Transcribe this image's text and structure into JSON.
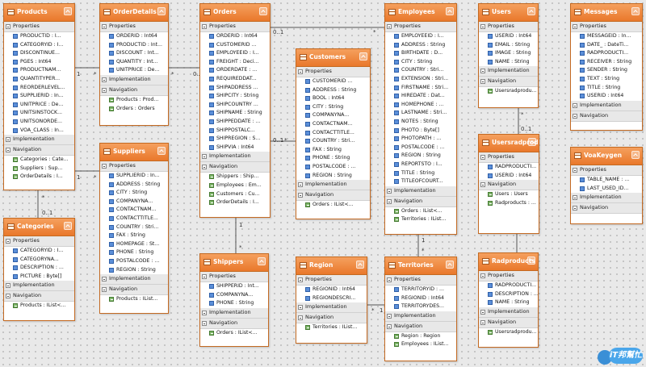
{
  "entities": [
    {
      "name": "Products",
      "sections": [
        {
          "title": "Properties",
          "items": [
            "PRODUCTID : I...",
            "CATEGORYID : I...",
            "DISCONTINUE...",
            "PGES : Int64",
            "PRODUCTNAM...",
            "QUANTITYPER...",
            "REORDERLEVEL...",
            "SUPPLIERID : In...",
            "UNITPRICE : De...",
            "UNITSINSTOCK...",
            "UNITSONORDE...",
            "VOA_CLASS : In..."
          ]
        },
        {
          "title": "Implementation",
          "items": []
        },
        {
          "title": "Navigation",
          "items": [
            "Categories : Cate...",
            "Suppliers : Sup...",
            "OrderDetails : I..."
          ]
        }
      ]
    },
    {
      "name": "OrderDetails",
      "sections": [
        {
          "title": "Properties",
          "items": [
            "ORDERID : Int64",
            "PRODUCTID : Int...",
            "DISCOUNT : Int...",
            "QUANTITY : Int...",
            "UNITPRICE : De..."
          ]
        },
        {
          "title": "Implementation",
          "items": []
        },
        {
          "title": "Navigation",
          "items": [
            "Products : Prod...",
            "Orders : Orders"
          ]
        }
      ]
    },
    {
      "name": "Orders",
      "sections": [
        {
          "title": "Properties",
          "items": [
            "ORDERID : Int64",
            "CUSTOMERID ...",
            "EMPLOYEEID : I...",
            "FREIGHT : Deci...",
            "ORDERDATE : ...",
            "REQUIREDDAT...",
            "SHIPADDRESS ...",
            "SHIPCITY : String",
            "SHIPCOUNTRY ...",
            "SHIPNAME : String",
            "SHIPPEDDATE : ...",
            "SHIPPOSTALC...",
            "SHIPREGION : S...",
            "SHIPVIA : Int64"
          ]
        },
        {
          "title": "Implementation",
          "items": []
        },
        {
          "title": "Navigation",
          "items": [
            "Shippers : Ship...",
            "Employees : Em...",
            "Customers : Cu...",
            "OrderDetails : I..."
          ]
        }
      ]
    },
    {
      "name": "Employees",
      "sections": [
        {
          "title": "Properties",
          "items": [
            "EMPLOYEEID : I...",
            "ADDRESS : String",
            "BIRTHDATE : D...",
            "CITY : String",
            "COUNTRY : Stri...",
            "EXTENSION : Stri...",
            "FIRSTNAME : Stri...",
            "HIREDATE : Dat...",
            "HOMEPHONE : ...",
            "LASTNAME : Stri...",
            "NOTES : String",
            "PHOTO : Byte[]",
            "PHOTOPATH : ...",
            "POSTALCODE : ...",
            "REGION : String",
            "REPORTSTO : I...",
            "TITLE : String",
            "TITLEOFCOURT..."
          ]
        },
        {
          "title": "Implementation",
          "items": []
        },
        {
          "title": "Navigation",
          "items": [
            "Orders : IList<...",
            "Territories : IList..."
          ]
        }
      ]
    },
    {
      "name": "Users",
      "sections": [
        {
          "title": "Properties",
          "items": [
            "USERID : Int64",
            "EMAIL : String",
            "IMAGE : String",
            "NAME : String"
          ]
        },
        {
          "title": "Implementation",
          "items": []
        },
        {
          "title": "Navigation",
          "items": [
            "Usersradprodu..."
          ]
        }
      ]
    },
    {
      "name": "Messages",
      "sections": [
        {
          "title": "Properties",
          "items": [
            "MESSAGEID : In...",
            "DATE_ : DateTi...",
            "RADPRODUCTI...",
            "RECEIVER : String",
            "SENDER : String",
            "TEXT : String",
            "TITLE : String",
            "USERID : Int64"
          ]
        },
        {
          "title": "Implementation",
          "items": []
        },
        {
          "title": "Navigation",
          "items": []
        }
      ]
    },
    {
      "name": "Customers",
      "sections": [
        {
          "title": "Properties",
          "items": [
            "CUSTOMERID ...",
            "ADDRESS : String",
            "BOOL : Int64",
            "CITY : String",
            "COMPANYNA...",
            "CONTACTNAM...",
            "CONTACTTITLE...",
            "COUNTRY : Stri...",
            "FAX : String",
            "PHONE : String",
            "POSTALCODE : ...",
            "REGION : String"
          ]
        },
        {
          "title": "Implementation",
          "items": []
        },
        {
          "title": "Navigation",
          "items": [
            "Orders : IList<..."
          ]
        }
      ]
    },
    {
      "name": "Suppliers",
      "sections": [
        {
          "title": "Properties",
          "items": [
            "SUPPLIERID : In...",
            "ADDRESS : String",
            "CITY : String",
            "COMPANYNA...",
            "CONTACTNAM...",
            "CONTACTTITLE...",
            "COUNTRY : Stri...",
            "FAX : String",
            "HOMEPAGE : St...",
            "PHONE : String",
            "POSTALCODE : ...",
            "REGION : String"
          ]
        },
        {
          "title": "Implementation",
          "items": []
        },
        {
          "title": "Navigation",
          "items": [
            "Products : IList..."
          ]
        }
      ]
    },
    {
      "name": "Usersradprodu...",
      "sections": [
        {
          "title": "Properties",
          "items": [
            "RADPRODUCTI...",
            "USERID : Int64"
          ]
        },
        {
          "title": "Navigation",
          "items": [
            "Users : Users",
            "Radproducts : ..."
          ]
        }
      ]
    },
    {
      "name": "VoaKeygen",
      "sections": [
        {
          "title": "Properties",
          "items": [
            "TABLE_NAME : ...",
            "LAST_USED_ID..."
          ]
        },
        {
          "title": "Implementation",
          "items": []
        },
        {
          "title": "Navigation",
          "items": []
        }
      ]
    },
    {
      "name": "Categories",
      "sections": [
        {
          "title": "Properties",
          "items": [
            "CATEGORYID : I...",
            "CATEGORYNA...",
            "DESCRIPTION : ...",
            "PICTURE : Byte[]"
          ]
        },
        {
          "title": "Implementation",
          "items": []
        },
        {
          "title": "Navigation",
          "items": [
            "Products : IList<..."
          ]
        }
      ]
    },
    {
      "name": "Shippers",
      "sections": [
        {
          "title": "Properties",
          "items": [
            "SHIPPERID : Int...",
            "COMPANYNA...",
            "PHONE : String"
          ]
        },
        {
          "title": "Implementation",
          "items": []
        },
        {
          "title": "Navigation",
          "items": [
            "Orders : IList<..."
          ]
        }
      ]
    },
    {
      "name": "Region",
      "sections": [
        {
          "title": "Properties",
          "items": [
            "REGIONID : Int64",
            "REGIONDESCRI..."
          ]
        },
        {
          "title": "Implementation",
          "items": []
        },
        {
          "title": "Navigation",
          "items": [
            "Territories : IList..."
          ]
        }
      ]
    },
    {
      "name": "Territories",
      "sections": [
        {
          "title": "Properties",
          "items": [
            "TERRITORYID : ...",
            "REGIONID : Int64",
            "TERRITORYDES..."
          ]
        },
        {
          "title": "Implementation",
          "items": []
        },
        {
          "title": "Navigation",
          "items": [
            "Region : Region",
            "Employees : IList..."
          ]
        }
      ]
    },
    {
      "name": "Radproducts",
      "sections": [
        {
          "title": "Properties",
          "items": [
            "RADPRODUCTI...",
            "DESCRIPTION : ...",
            "NAME : String"
          ]
        },
        {
          "title": "Implementation",
          "items": []
        },
        {
          "title": "Navigation",
          "items": [
            "Usersradprodu..."
          ]
        }
      ]
    }
  ],
  "multiplicities": [
    "1",
    "*",
    "1",
    "*",
    "*",
    "0..1",
    "*",
    "0..1",
    "0..1",
    "*",
    "0..1",
    "*",
    "1",
    "*",
    "1",
    "*",
    "*",
    "1",
    "*",
    "0..1"
  ],
  "watermark": "iT邦幫忙",
  "colors": {
    "header": "#ec7d32",
    "border": "#c46a22",
    "background": "#e9e9e9"
  }
}
